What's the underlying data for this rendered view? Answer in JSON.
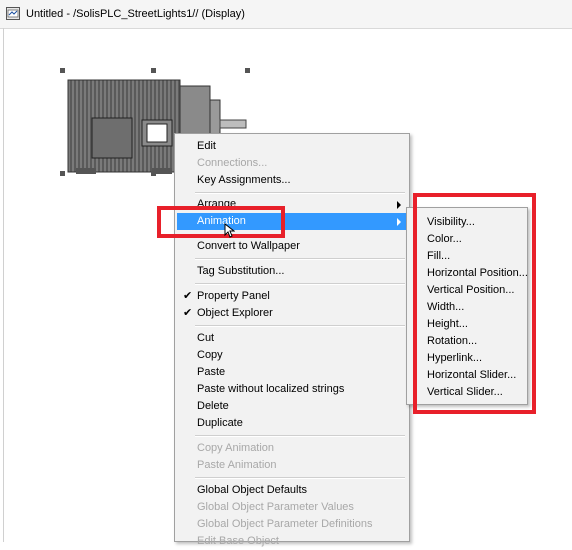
{
  "window": {
    "title": "Untitled - /SolisPLC_StreetLights1// (Display)",
    "icon": "display-editor-icon"
  },
  "context_menu": {
    "items": [
      {
        "label": "Edit",
        "enabled": true
      },
      {
        "label": "Connections...",
        "enabled": false
      },
      {
        "label": "Key Assignments...",
        "enabled": true
      },
      {
        "label": "Arrange",
        "enabled": true,
        "submenu": true
      },
      {
        "label": "Animation",
        "enabled": true,
        "submenu": true,
        "highlighted": true
      },
      {
        "label": "Convert to Wallpaper",
        "enabled": true
      },
      {
        "label": "Tag Substitution...",
        "enabled": true
      },
      {
        "label": "Property Panel",
        "enabled": true,
        "checked": true
      },
      {
        "label": "Object Explorer",
        "enabled": true,
        "checked": true
      },
      {
        "label": "Cut",
        "enabled": true
      },
      {
        "label": "Copy",
        "enabled": true
      },
      {
        "label": "Paste",
        "enabled": true
      },
      {
        "label": "Paste without localized strings",
        "enabled": true
      },
      {
        "label": "Delete",
        "enabled": true
      },
      {
        "label": "Duplicate",
        "enabled": true
      },
      {
        "label": "Copy Animation",
        "enabled": false
      },
      {
        "label": "Paste Animation",
        "enabled": false
      },
      {
        "label": "Global Object Defaults",
        "enabled": true
      },
      {
        "label": "Global Object Parameter Values",
        "enabled": false
      },
      {
        "label": "Global Object Parameter Definitions",
        "enabled": false
      },
      {
        "label": "Edit Base Object",
        "enabled": false
      }
    ]
  },
  "animation_submenu": {
    "items": [
      "Visibility...",
      "Color...",
      "Fill...",
      "Horizontal Position...",
      "Vertical Position...",
      "Width...",
      "Height...",
      "Rotation...",
      "Hyperlink...",
      "Horizontal Slider...",
      "Vertical Slider..."
    ]
  },
  "check_glyph": "✔",
  "colors": {
    "highlight": "#3399ff",
    "annotation_red": "#e8202a",
    "disabled_text": "#a8a8a8",
    "menu_background": "#f2f2f2"
  }
}
